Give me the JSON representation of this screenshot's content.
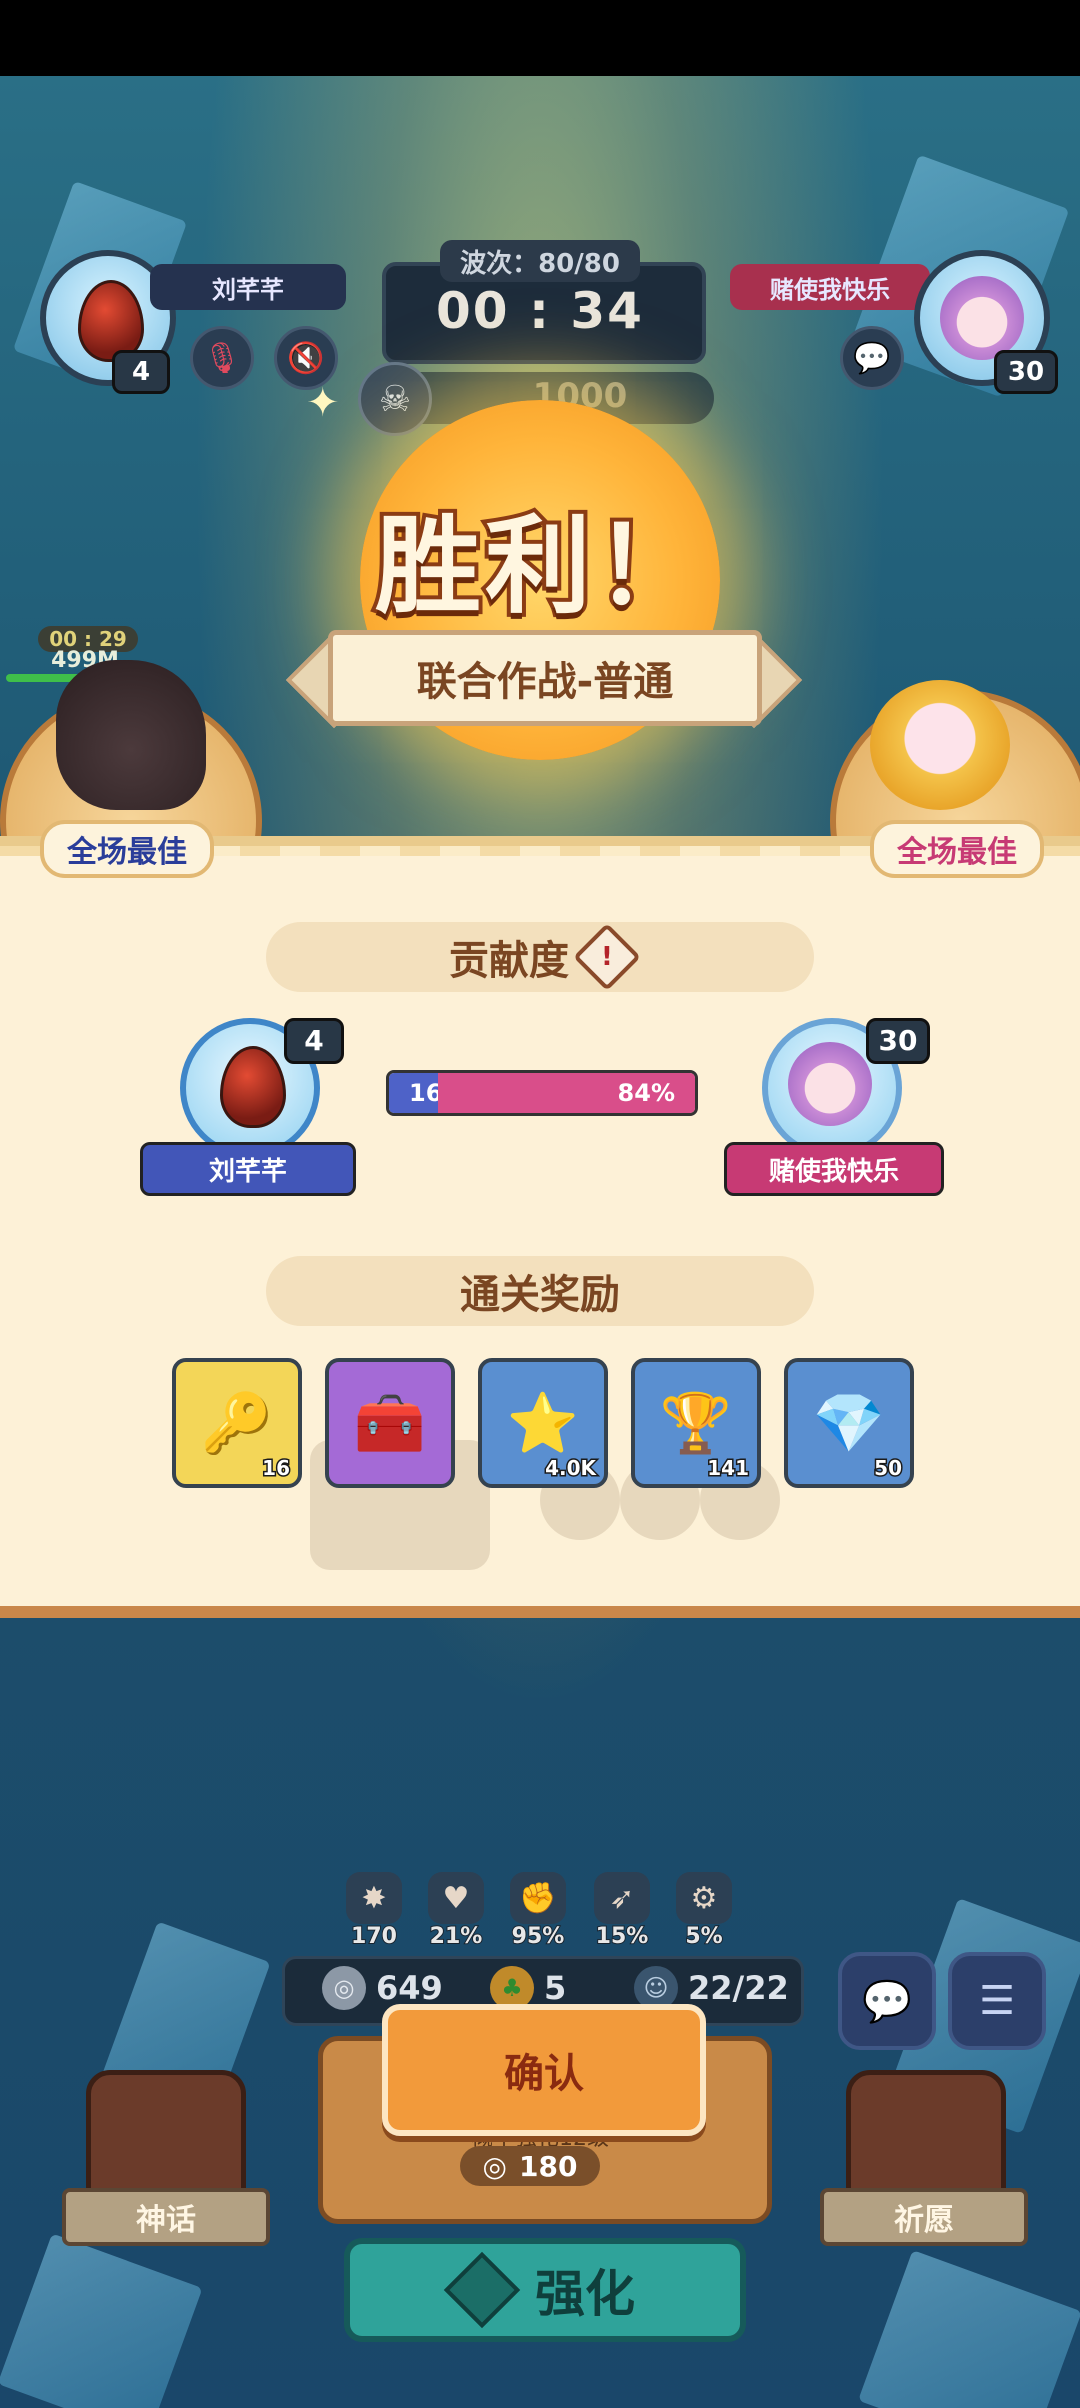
{
  "hud": {
    "player1_name": "刘芊芊",
    "player1_level": "4",
    "player2_name": "赌使我快乐",
    "player2_level": "30",
    "wave": "波次：80/80",
    "timer": "00 : 34",
    "boss_value": "1000"
  },
  "battle": {
    "mvp_timer": "00 : 29",
    "distance": "499M"
  },
  "victory": {
    "title": "胜利！",
    "mode": "联合作战-普通",
    "mvp_label": "全场最佳"
  },
  "contribution": {
    "heading": "贡献度",
    "player1": {
      "name": "刘芊芊",
      "level": "4",
      "percent": "16%",
      "fraction": 0.16
    },
    "player2": {
      "name": "赌使我快乐",
      "level": "30",
      "percent": "84%"
    }
  },
  "rewards": {
    "heading": "通关奖励",
    "items": [
      {
        "icon": "key-icon",
        "count": "16",
        "color": "#f3d658"
      },
      {
        "icon": "chest-icon",
        "count": "",
        "color": "#a46ad6"
      },
      {
        "icon": "coin-icon",
        "count": "4.0K",
        "color": "#5a8fd0"
      },
      {
        "icon": "trophy-icon",
        "count": "141",
        "color": "#5a8fd0"
      },
      {
        "icon": "crystal-icon",
        "count": "50",
        "color": "#5a8fd0"
      }
    ]
  },
  "stats": [
    "170",
    "21%",
    "95%",
    "15%",
    "5%"
  ],
  "resources": {
    "silver": "649",
    "clover": "5",
    "units": "22/22"
  },
  "actions": {
    "confirm": "确认",
    "upgrade_cost": "180",
    "upgrade_prob": "概率强化12级",
    "enhance": "强化",
    "myth": "神话",
    "wish": "祈愿"
  }
}
